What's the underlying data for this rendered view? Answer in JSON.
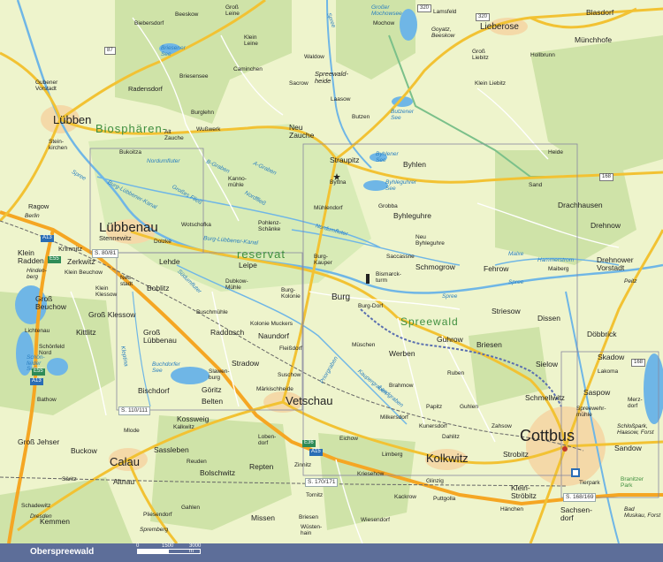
{
  "map": {
    "big_towns": [
      "Lübben",
      "Lübbenau",
      "Vetschau",
      "Calau",
      "Cottbus",
      "Kolkwitz"
    ],
    "regions": {
      "biosphaeren": "Biosphären-",
      "reservat": "reservat",
      "spreewald": "Spreewald"
    },
    "places": {
      "beeskow": "Beeskow",
      "gross_leine": "Groß\nLeine",
      "biebersdorf": "Biebersdorf",
      "klein_leine": "Klein\nLeine",
      "briesener_see": "Briesener\nSee",
      "briesensee": "Briesensee",
      "caminchen": "Caminchen",
      "waldow": "Waldow",
      "grosser_mochowsee": "Großer\nMochowsee",
      "mochow": "Mochow",
      "lamsfeld": "Lamsfeld",
      "blasdorf": "Blasdorf",
      "lieberose": "Lieberose",
      "goyatz": "Goyatz,\nBeeskow",
      "muenchhofe": "Münchhofe",
      "gross_liebitz": "Groß\nLiebitz",
      "hollbrunn": "Hollbrunn",
      "klein_liebitz": "Klein Liebitz",
      "guebener_vorstadt": "Gubener\nVorstadt",
      "radensdorf": "Radensdorf",
      "sacrow": "Sacrow",
      "spreewaldheide": "Spreewald-\nheide",
      "laasow": "Laasow",
      "butzen": "Butzen",
      "butzener_see": "Butzener\nSee",
      "burglehn": "Burglehn",
      "alt_zauche": "Alt\nZauche",
      "wusswerk": "Wußwerk",
      "neu_zauche": "Neu\nZauche",
      "steinkirchen": "Stein-\nkirchen",
      "bukoitza": "Bukoitza",
      "nordumfluter": "Nordumfluter",
      "straupitz": "Straupitz",
      "byhlener_see": "Byhlener\nSee",
      "byhlen": "Byhlen",
      "heide": "Heide",
      "byttna": "Byttna",
      "byhleguhrer_see": "Byhleguhrer\nSee",
      "sand": "Sand",
      "kannomuehle": "Kanno-\nmühle",
      "ragow": "Ragow",
      "berlin": "Berlin",
      "muehlendorf": "Mühlendorf",
      "grobba": "Grobba",
      "byhleguhre": "Byhleguhre",
      "drachhausen": "Drachhausen",
      "wotschofka": "Wotschofka",
      "pohlenz_schaenke": "Pohlenz-\nSchänke",
      "stennewitz": "Stennewitz",
      "krimnitz": "Krimnitz",
      "dolzke": "Dolzke",
      "neu_byhleguhre": "Neu\nByhleguhre",
      "drehnow": "Drehnow",
      "klein_radden": "Klein\nRadden",
      "zerkwitz": "Zerkwitz",
      "klein_beuchow": "Klein Beuchow",
      "hindenberg": "Hinden-\nberg",
      "lehde": "Lehde",
      "leipe": "Leipe",
      "burg_kauper": "Burg-\nKauper",
      "saccassne": "Saccassne",
      "schmogrow": "Schmogrow",
      "fehrow": "Fehrow",
      "hammerstrom": "Hammerstrom",
      "maiberg": "Maiberg",
      "drehnower_vorstadt": "Drehnower\nVorstadt",
      "neustadt": "Neu-\nstadt",
      "boblitz": "Boblitz",
      "dubkow_muehle": "Dubkow-\nMühle",
      "burg_kolonie": "Burg-\nKolonie",
      "bismarckturm": "Bismarck-\nturm",
      "gross_beuchow": "Groß\nBeuchow",
      "klein_klessow": "Klein\nKlessow",
      "gross_klessow": "Groß Klessow",
      "burg": "Burg",
      "burg_dorf": "Burg-Dorf",
      "peitz": "Peitz",
      "kittlitz": "Kittlitz",
      "buschmuehle": "Buschmühle",
      "kolonie_muckers": "Kolonie Muckers",
      "striesow": "Striesow",
      "dissen": "Dissen",
      "lichtenau": "Lichtenau",
      "gross_luebbenau": "Groß\nLübbenau",
      "raddusch": "Raddusch",
      "naundorf": "Naundorf",
      "guhrow": "Guhrow",
      "doebbrick": "Döbbrick",
      "schoenfeld_nord": "Schönfeld\nNord",
      "schoenfelder_see": "Schön-\nfelder\nSee",
      "fleissdorf": "Fleißdorf",
      "mueschen": "Müschen",
      "briesen": "Briesen",
      "skadow": "Skadow",
      "werben": "Werben",
      "buchdorfer_see": "Buchdorfer\nSee",
      "slawenburg": "Slawen-\nburg",
      "stradow": "Stradow",
      "sielow": "Sielow",
      "lakoma": "Lakoma",
      "suschow": "Suschow",
      "rubén": "Ruben",
      "brahmow": "Brahmow",
      "bischdorf": "Bischdorf",
      "goeritz": "Göritz",
      "maerkischheide": "Märkischheide",
      "schmellwitz": "Schmellwitz",
      "saspow": "Saspow",
      "merzdorf": "Merz-\ndorf",
      "bathow": "Bathow",
      "belten": "Belten",
      "papitz": "Papitz",
      "guhlen": "Guhlen",
      "spreewehrmuehle": "Spreewehr-\nmühle",
      "kossweig": "Kossweig",
      "milkersdorf": "Milkersdorf",
      "kunersdorf": "Kunersdorf",
      "zahsow": "Zahsow",
      "kalkwitz": "Kalkwitz",
      "mlode": "Mlode",
      "dahlitz": "Dahlitz",
      "schlosspark": "Schloßpark,\nHaasow, Forst",
      "gross_jehser": "Groß Jehser",
      "lobendorf": "Loben-\ndorf",
      "eichow": "Eichow",
      "sandow": "Sandow",
      "buckow": "Buckow",
      "sassleben": "Sassleben",
      "limberg": "Limberg",
      "strobitz": "Strobitz",
      "reuden": "Reuden",
      "boesendorf": "Bolschwitz",
      "repten": "Repten",
      "zinnitz": "Zinnitz",
      "kriesehow": "Kriesehow",
      "tierpark": "Tierpark",
      "branitzer_park": "Branitzer\nPark",
      "saeritz": "Säritz",
      "altnau": "Altnau",
      "glinzig": "Glinzig",
      "klein_stroebitz": "Klein-\nStröbitz",
      "schadewitz": "Schadewitz",
      "kackrow": "Kackrow",
      "puttgolla": "Puttgolla",
      "gahlen": "Gahlen",
      "dresden": "Dresden",
      "kemmen": "Kemmen",
      "pliesendorf": "Pliesendorf",
      "missen": "Missen",
      "tornitz": "Tornitz",
      "wiesendorf": "Wiesendorf",
      "haenchen": "Hänchen",
      "sachsendorf": "Sachsen-\ndorf",
      "bad_muskau": "Bad\nMuskau, Forst",
      "spremberg": "Spremberg",
      "briesen2": "Briesen",
      "wuestenhain": "Wüsten-\nhain"
    },
    "water_labels": {
      "spree_n": "Spree",
      "spree_e": "Spree",
      "spree_m": "Spree",
      "nordumfluter2": "Nordumfluter",
      "b_graben": "B-Graben",
      "a_graben": "A-Graben",
      "nordfliess": "Nordfließ",
      "grosses_fliess": "Großes Fließ",
      "luebbenau_kanal": "Burg-Lübbener-Kanal",
      "suedumfluter": "Südumfluter",
      "kleines": "Burg-Lübbener-Kanal",
      "malxe": "Malxe",
      "priorgraben": "Priorgraben",
      "kaupergraben": "Kaupergraben",
      "landgraben": "Landgraben",
      "kleptina": "Kleptina",
      "ginn": "Sandower Spree",
      "nordfliess2": "Nordfließ",
      "kleine_spree": "Kleine Spree"
    },
    "roads": {
      "b87": "87",
      "b320a": "320",
      "b320b": "320",
      "b168a": "168",
      "b168b": "168",
      "b115": "115",
      "a13a": "A13",
      "a13b": "A13",
      "a15": "A15",
      "e55a": "E55",
      "e55b": "E55",
      "e36": "E36"
    },
    "page_refs": {
      "r1": "S. 80/81",
      "r2": "S. 110/111",
      "r3": "S. 170/171",
      "r4": "S. 168/169"
    },
    "colors": {
      "land": "#eef4cc",
      "forest": "#cfe3a8",
      "water": "#6fb6e6",
      "road_major": "#f2c233",
      "road_minor": "#ffffff",
      "motorway": "#f5a623",
      "settlement": "#f4d9a8",
      "grid": "#8888a0",
      "trail": "#5a6fb0"
    }
  },
  "footer": {
    "title": "Oberspreewald",
    "scale_0": "0",
    "scale_1": "1500",
    "scale_2": "3000 m"
  }
}
